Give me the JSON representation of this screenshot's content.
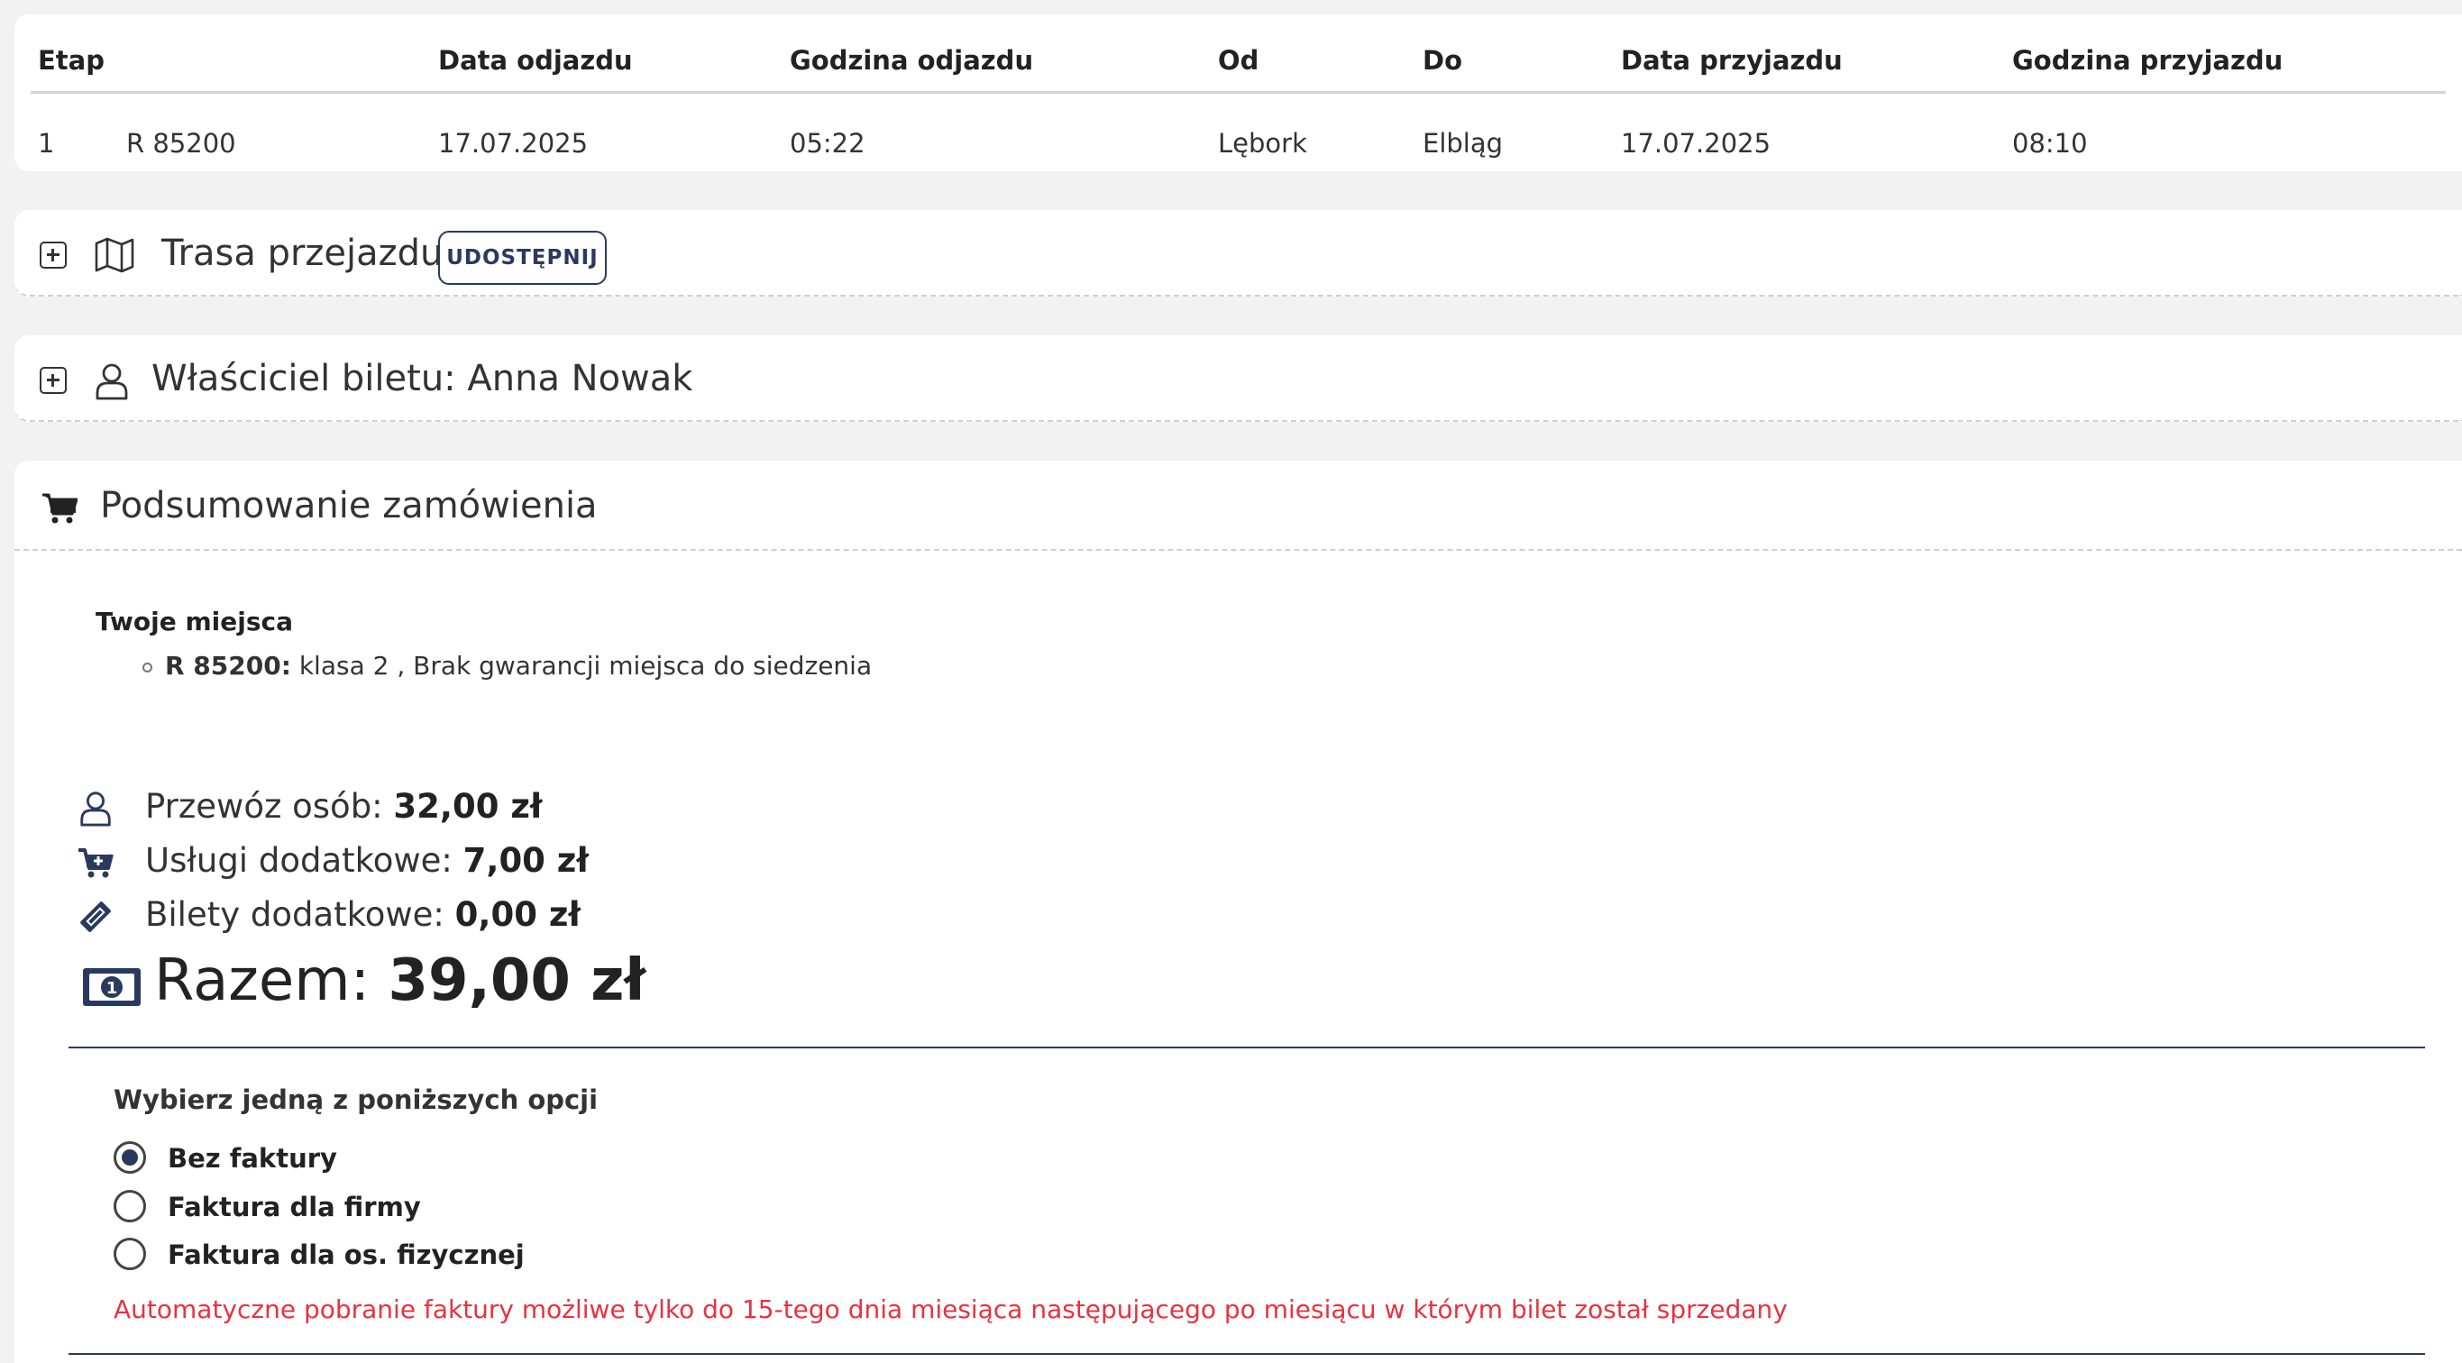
{
  "journey_table": {
    "headers": [
      "Etap",
      "",
      "Data odjazdu",
      "Godzina odjazdu",
      "Od",
      "Do",
      "Data przyjazdu",
      "Godzina przyjazdu"
    ],
    "rows": [
      [
        "1",
        "R 85200",
        "17.07.2025",
        "05:22",
        "Lębork",
        "Elbląg",
        "17.07.2025",
        "08:10"
      ]
    ]
  },
  "route_section": {
    "title": "Trasa przejazdu",
    "share_label": "UDOSTĘPNIJ",
    "icons": [
      "expand-icon",
      "map-icon"
    ]
  },
  "owner_section": {
    "title": "Właściciel biletu: Anna Nowak",
    "icons": [
      "expand-icon",
      "user-icon"
    ]
  },
  "summary": {
    "title": "Podsumowanie zamówienia",
    "seats_title": "Twoje miejsca",
    "seat": {
      "train": "R 85200:",
      "details": " klasa 2 , Brak gwarancji miejsca do siedzenia"
    },
    "prices": [
      {
        "label": "Przewóz osób: ",
        "value": "32,00 zł",
        "icon": "user-icon"
      },
      {
        "label": "Usługi dodatkowe: ",
        "value": "7,00 zł",
        "icon": "cart-plus-icon"
      },
      {
        "label": "Bilety dodatkowe: ",
        "value": "0,00 zł",
        "icon": "ticket-icon"
      }
    ],
    "total": {
      "label": "Razem: ",
      "value": "39,00 zł",
      "icon": "money-icon"
    },
    "invoice": {
      "title": "Wybierz jedną z poniższych opcji",
      "options": [
        "Bez faktury",
        "Faktura dla firmy",
        "Faktura dla os. fizycznej"
      ],
      "selected": "Bez faktury",
      "warning": "Automatyczne pobranie faktury możliwe tylko do 15-tego dnia miesiąca następującego po miesiącu w którym bilet został sprzedany"
    }
  },
  "colors": {
    "accent": "#2a3a5e",
    "warning": "#e8323f",
    "background": "#f2f2f2"
  }
}
